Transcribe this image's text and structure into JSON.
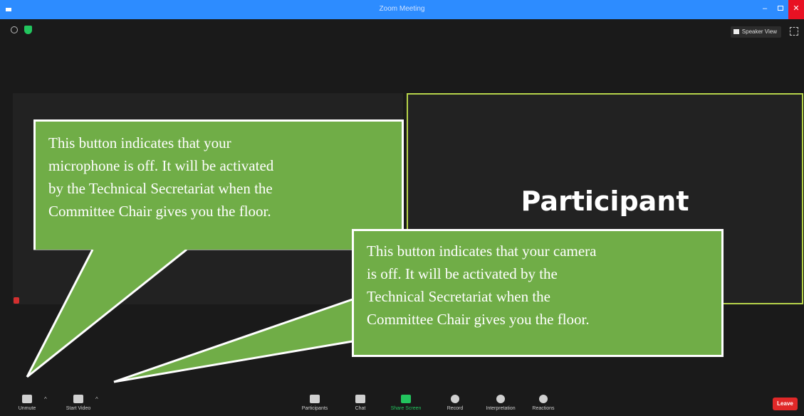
{
  "window": {
    "title": "Zoom Meeting"
  },
  "top_bar": {
    "speaker_view_label": "Speaker View"
  },
  "participant_tile": {
    "name": "Participant"
  },
  "callouts": {
    "microphone": {
      "lines": [
        "This button indicates that your",
        "microphone is off. It will be activated",
        "by the Technical Secretariat when the",
        "Committee Chair gives you the floor."
      ]
    },
    "camera": {
      "lines": [
        "This button indicates that your camera",
        "is off. It will be activated by the",
        "Technical Secretariat when the",
        "Committee Chair gives you the floor."
      ]
    }
  },
  "toolbar": {
    "unmute_label": "Unmute",
    "start_video_label": "Start Video",
    "participants_label": "Participants",
    "chat_label": "Chat",
    "share_screen_label": "Share Screen",
    "record_label": "Record",
    "interpretation_label": "Interpretation",
    "reactions_label": "Reactions",
    "leave_label": "Leave"
  },
  "colors": {
    "callout_fill": "#70ad47",
    "active_speaker_border": "#b6d34a",
    "title_bar": "#2d8cff",
    "leave_button": "#e02828",
    "share_screen": "#22c55e"
  }
}
